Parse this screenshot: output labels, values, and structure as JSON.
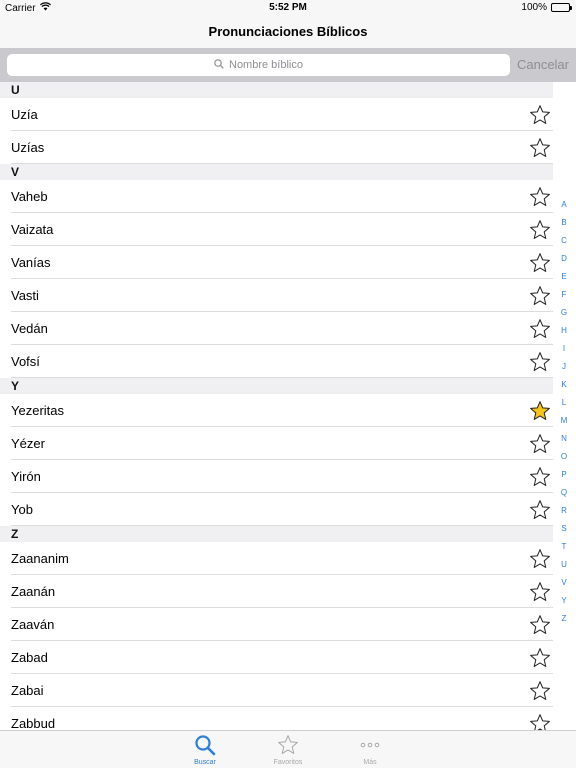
{
  "status_bar": {
    "carrier": "Carrier",
    "time": "5:52 PM",
    "battery": "100%",
    "battery_level": 1.0
  },
  "nav": {
    "title": "Pronunciaciones Bíblicos"
  },
  "search": {
    "placeholder": "Nombre bíblico",
    "cancel_label": "Cancelar"
  },
  "sections": [
    {
      "letter": "U",
      "items": [
        {
          "name": "Uzía",
          "favorite": false
        },
        {
          "name": "Uzías",
          "favorite": false
        }
      ]
    },
    {
      "letter": "V",
      "items": [
        {
          "name": "Vaheb",
          "favorite": false
        },
        {
          "name": "Vaizata",
          "favorite": false
        },
        {
          "name": "Vanías",
          "favorite": false
        },
        {
          "name": "Vasti",
          "favorite": false
        },
        {
          "name": "Vedán",
          "favorite": false
        },
        {
          "name": "Vofsí",
          "favorite": false
        }
      ]
    },
    {
      "letter": "Y",
      "items": [
        {
          "name": "Yezeritas",
          "favorite": true
        },
        {
          "name": "Yézer",
          "favorite": false
        },
        {
          "name": "Yirón",
          "favorite": false
        },
        {
          "name": "Yob",
          "favorite": false
        }
      ]
    },
    {
      "letter": "Z",
      "items": [
        {
          "name": "Zaananim",
          "favorite": false
        },
        {
          "name": "Zaanán",
          "favorite": false
        },
        {
          "name": "Zaaván",
          "favorite": false
        },
        {
          "name": "Zabad",
          "favorite": false
        },
        {
          "name": "Zabai",
          "favorite": false
        },
        {
          "name": "Zabbud",
          "favorite": false
        }
      ]
    }
  ],
  "index_letters": [
    "A",
    "B",
    "C",
    "D",
    "E",
    "F",
    "G",
    "H",
    "I",
    "J",
    "K",
    "L",
    "M",
    "N",
    "O",
    "P",
    "Q",
    "R",
    "S",
    "T",
    "U",
    "V",
    "Y",
    "Z"
  ],
  "tabs": [
    {
      "label": "Buscar",
      "icon": "search-icon",
      "active": true
    },
    {
      "label": "Favoritos",
      "icon": "star-icon",
      "active": false
    },
    {
      "label": "Más",
      "icon": "more-icon",
      "active": false
    }
  ],
  "colors": {
    "accent": "#2d7ed8",
    "favorite_fill": "#f5c518",
    "inactive": "#a8a8a8"
  }
}
